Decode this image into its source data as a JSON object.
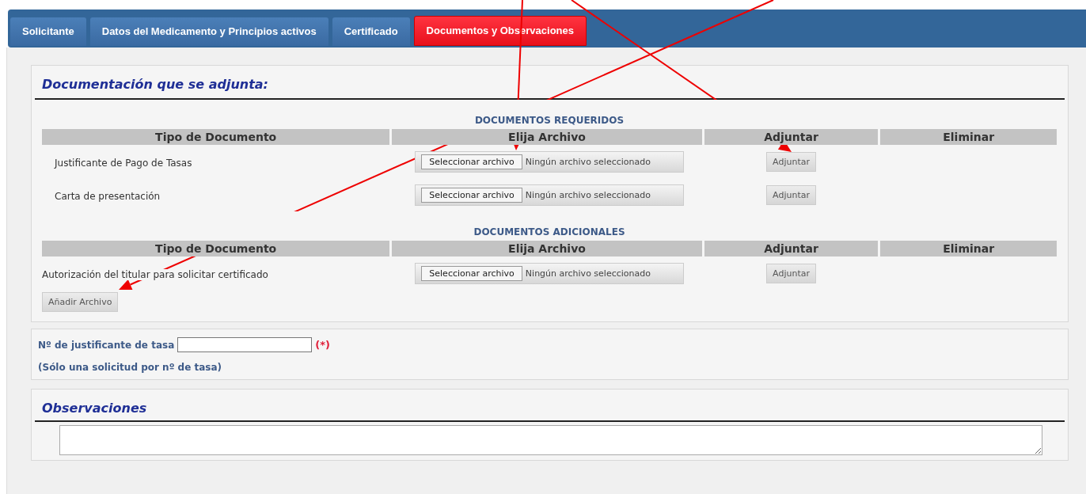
{
  "tabs": [
    {
      "label": "Solicitante",
      "selected": false
    },
    {
      "label": "Datos del Medicamento y Principios activos",
      "selected": false
    },
    {
      "label": "Certificado",
      "selected": false
    },
    {
      "label": "Documentos y Observaciones",
      "selected": true
    }
  ],
  "documentation": {
    "title": "Documentación que se adjunta:",
    "groups": [
      {
        "kind": "required",
        "heading": "DOCUMENTOS REQUERIDOS",
        "columns": [
          "Tipo de Documento",
          "Elija Archivo",
          "Adjuntar",
          "Eliminar"
        ],
        "rows": [
          {
            "label": "Justificante de Pago de Tasas",
            "choose_button": "Seleccionar archivo",
            "file_status": "Ningún archivo seleccionado",
            "attach_button": "Adjuntar"
          },
          {
            "label": "Carta de presentación",
            "choose_button": "Seleccionar archivo",
            "file_status": "Ningún archivo seleccionado",
            "attach_button": "Adjuntar"
          }
        ]
      },
      {
        "kind": "additional",
        "heading": "DOCUMENTOS ADICIONALES",
        "columns": [
          "Tipo de Documento",
          "Elija Archivo",
          "Adjuntar",
          "Eliminar"
        ],
        "rows": [
          {
            "label": "Autorización del titular para solicitar certificado",
            "choose_button": "Seleccionar archivo",
            "file_status": "Ningún archivo seleccionado",
            "attach_button": "Adjuntar"
          }
        ]
      }
    ],
    "add_button": "Añadir Archivo"
  },
  "tax_receipt": {
    "label": "Nº de justificante de tasa",
    "required_mark": "(*)",
    "note": "(Sólo una solicitud por nº de tasa)"
  },
  "observations": {
    "title": "Observaciones"
  }
}
